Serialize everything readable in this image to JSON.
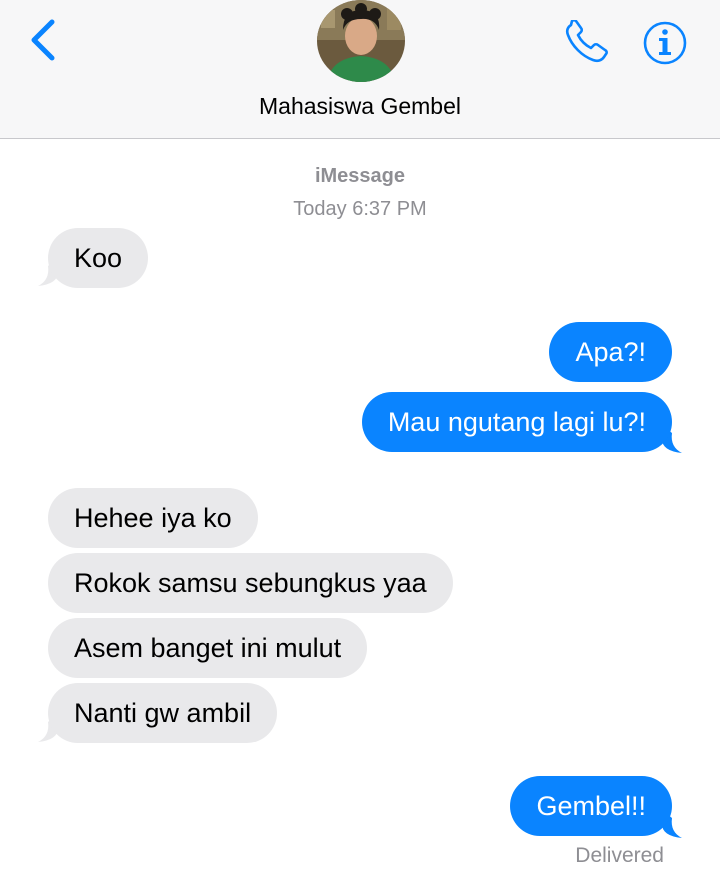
{
  "header": {
    "contact_name": "Mahasiswa Gembel"
  },
  "thread": {
    "service": "iMessage",
    "timestamp": "Today 6:37 PM",
    "messages": [
      {
        "from": "them",
        "text": "Koo"
      },
      {
        "from": "me",
        "text": "Apa?!"
      },
      {
        "from": "me",
        "text": "Mau ngutang lagi lu?!"
      },
      {
        "from": "them",
        "text": "Hehee iya ko"
      },
      {
        "from": "them",
        "text": "Rokok samsu sebungkus yaa"
      },
      {
        "from": "them",
        "text": "Asem banget ini mulut"
      },
      {
        "from": "them",
        "text": "Nanti gw ambil"
      },
      {
        "from": "me",
        "text": "Gembel!!"
      }
    ],
    "status": "Delivered"
  },
  "colors": {
    "accent": "#0a84ff",
    "incoming_bubble": "#e9e9eb",
    "meta_text": "#8e8e93"
  },
  "icons": [
    "back-chevron-icon",
    "phone-icon",
    "info-icon"
  ]
}
